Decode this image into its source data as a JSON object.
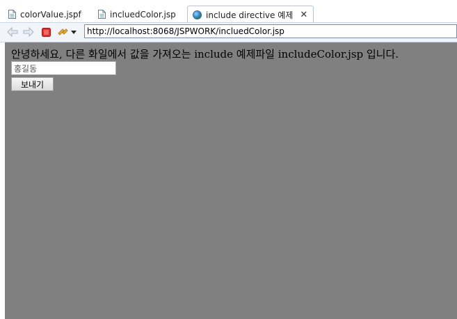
{
  "tabs": [
    {
      "label": "colorValue.jspf",
      "icon": "file-icon"
    },
    {
      "label": "incluedColor.jsp",
      "icon": "file-icon"
    },
    {
      "label": "include directive 예제",
      "icon": "globe-icon",
      "active": true
    }
  ],
  "toolbar": {
    "back_icon": "arrow-left-icon",
    "forward_icon": "arrow-right-icon",
    "stop_icon": "stop-icon",
    "refresh_icon": "refresh-icon",
    "url": "http://localhost:8068/JSPWORK/incluedColor.jsp"
  },
  "page": {
    "message": "안녕하세요, 다른 화일에서 값을 가져오는 include 예제파일 includeColor.jsp 입니다.",
    "name_value": "홍길동",
    "send_label": "보내기"
  },
  "colors": {
    "page_background": "#808080",
    "accent": "#3a8fd6"
  }
}
